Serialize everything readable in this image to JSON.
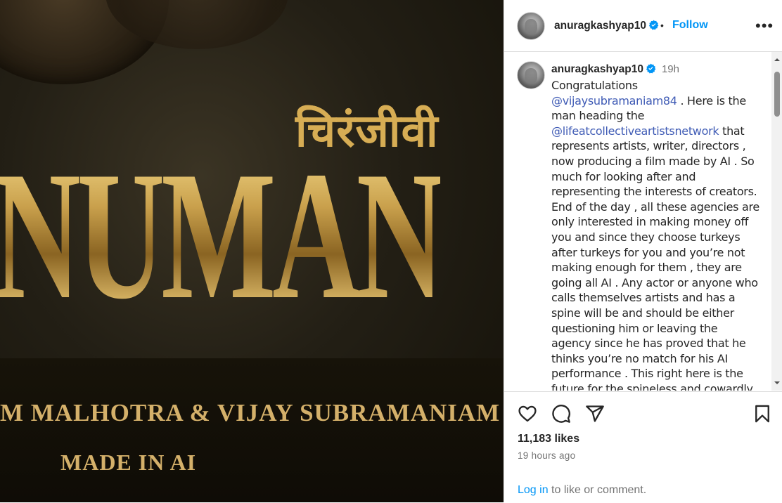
{
  "media": {
    "hindi_title": "चिरंजीवी",
    "main_title": "NUMAN",
    "credits": "M MALHOTRA & VIJAY SUBRAMANIAM",
    "tagline": "MADE IN AI"
  },
  "post": {
    "header": {
      "username": "anuragkashyap10",
      "follow_label": "Follow",
      "more_label": "•••"
    },
    "caption": {
      "username": "anuragkashyap10",
      "time": "19h",
      "text_1": "Congratulations ",
      "mention_1": "@vijaysubramaniam84",
      "text_2": " . Here is the man heading the ",
      "mention_2": "@lifeatcollectiveartistsnetwork",
      "text_3": " that represents artists, writer, directors , now producing a film made by AI . So much for looking after and representing the interests of creators. End of the day , all these agencies are only interested in making money off you and since they choose turkeys after turkeys for you and you’re not making enough for them , they are going all AI . Any actor or anyone who calls themselves artists and has a spine will be and should be either questioning him or leaving the agency since he has proved that he thinks you’re no match for his AI performance . This right here is the future for the spineless and cowardly so called artists in the Hindi Film industry. Well done"
    },
    "likes": "11,183 likes",
    "posted_ago": "19 hours ago",
    "login_link": "Log in",
    "login_suffix": " to like or comment."
  },
  "colors": {
    "link_blue": "#0095f6",
    "mention_blue": "#3f5bb5",
    "verified_blue": "#0095f6",
    "gold": "#d4b06a"
  },
  "icons": [
    "heart-icon",
    "comment-icon",
    "share-icon",
    "bookmark-icon",
    "verified-badge-icon",
    "more-options-icon"
  ]
}
